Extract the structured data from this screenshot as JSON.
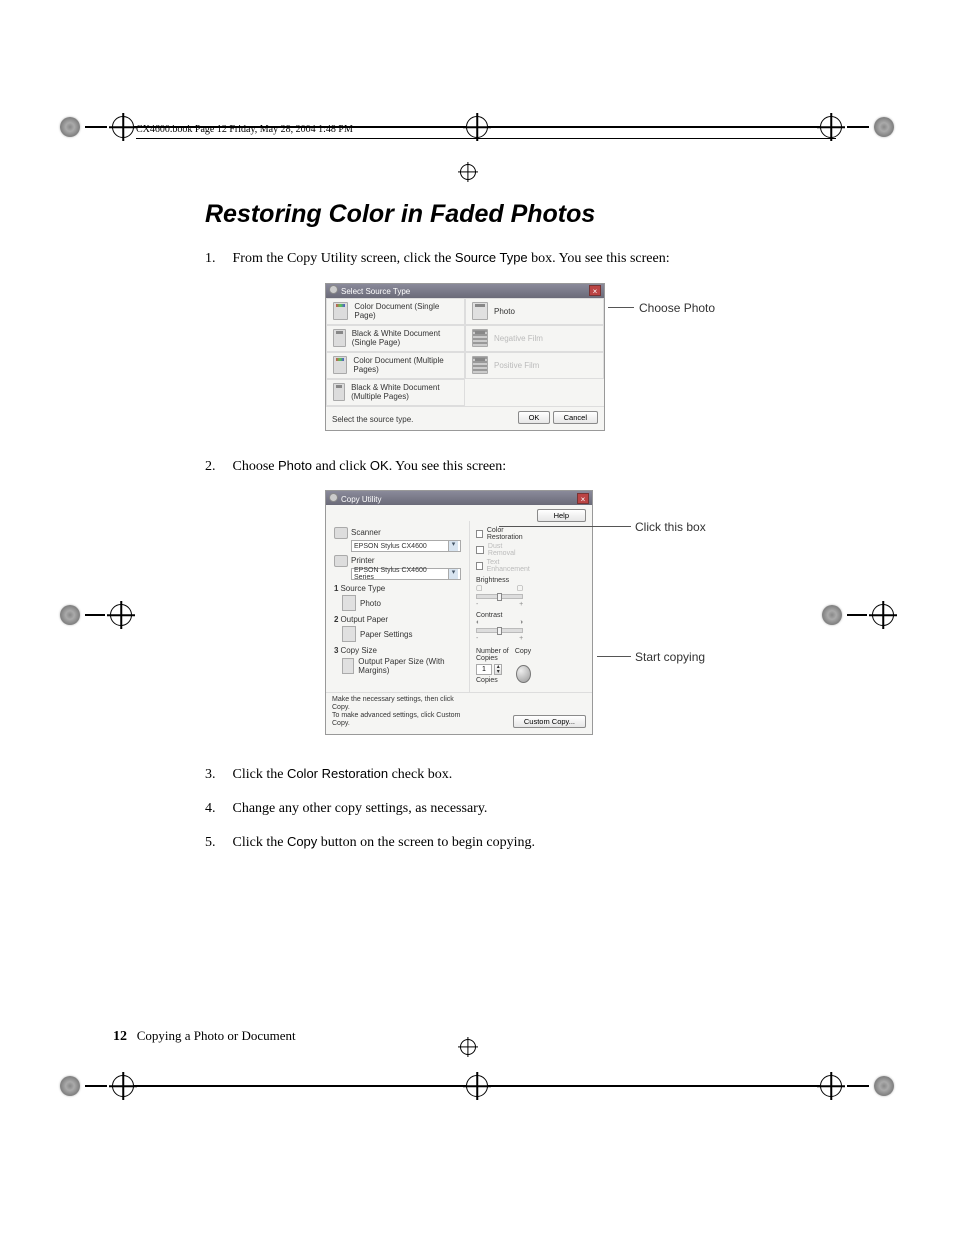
{
  "header_line": "CX4600.book  Page 12  Friday, May 28, 2004  1:48 PM",
  "heading": "Restoring Color in Faded Photos",
  "steps": [
    {
      "num": "1.",
      "text_before": "From the Copy Utility screen, click the ",
      "bold": "Source Type",
      "text_after": " box. You see this screen:"
    },
    {
      "num": "2.",
      "text_before": "Choose ",
      "bold": "Photo",
      "mid": " and click ",
      "bold2": "OK",
      "text_after": ". You see this screen:"
    },
    {
      "num": "3.",
      "text_before": "Click the ",
      "bold": "Color Restoration",
      "text_after": " check box."
    },
    {
      "num": "4.",
      "text_before": "Change any other copy settings, as necessary.",
      "bold": "",
      "text_after": ""
    },
    {
      "num": "5.",
      "text_before": "Click the ",
      "bold": "Copy",
      "text_after": " button on the screen to begin copying."
    }
  ],
  "dialog1": {
    "title": "Select Source Type",
    "options_left": [
      "Color Document (Single Page)",
      "Black & White Document (Single Page)",
      "Color Document (Multiple Pages)",
      "Black & White Document (Multiple Pages)"
    ],
    "options_right": [
      {
        "label": "Photo",
        "enabled": true
      },
      {
        "label": "Negative Film",
        "enabled": false
      },
      {
        "label": "Positive Film",
        "enabled": false
      }
    ],
    "hint": "Select the source type.",
    "ok": "OK",
    "cancel": "Cancel"
  },
  "callout1": "Choose Photo",
  "dialog2": {
    "title": "Copy Utility",
    "help": "Help",
    "scanner_label": "Scanner",
    "scanner_value": "EPSON Stylus CX4600",
    "printer_label": "Printer",
    "printer_value": "EPSON Stylus CX4600 Series",
    "s1": "1",
    "s1_label": "Source Type",
    "s1_value": "Photo",
    "s2": "2",
    "s2_label": "Output Paper",
    "s2_value": "Paper Settings",
    "s3": "3",
    "s3_label": "Copy Size",
    "s3_value": "Output Paper Size (With Margins)",
    "cb1": "Color Restoration",
    "cb2": "Dust Removal",
    "cb3": "Text Enhancement",
    "brightness": "Brightness",
    "contrast": "Contrast",
    "copies_label": "Number of Copies",
    "copies_value": "1",
    "copies_unit": "Copies",
    "copy_label": "Copy",
    "footer_note": "Make the necessary settings, then click Copy.\nTo make advanced settings, click Custom Copy.",
    "custom": "Custom Copy..."
  },
  "callout2a": "Click this box",
  "callout2b": "Start copying",
  "page_footer_num": "12",
  "page_footer_text": "Copying a Photo or Document"
}
